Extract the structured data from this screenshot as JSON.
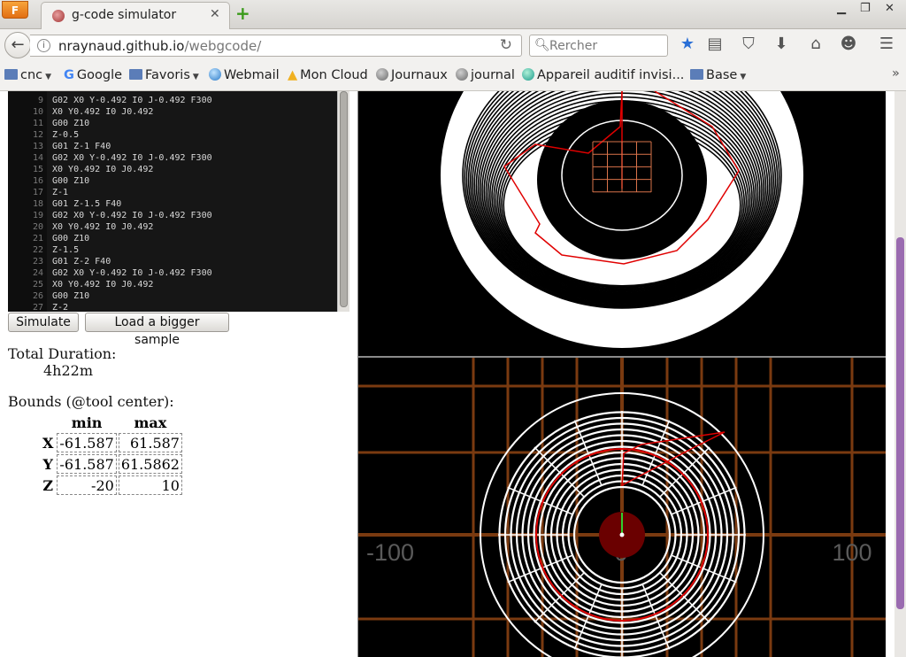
{
  "browser": {
    "menu_label": "F",
    "tab_title": "g-code simulator",
    "tab_close": "✕",
    "new_tab": "+",
    "url_host": "nraynaud.github.io",
    "url_path": "/webgcode/",
    "search_placeholder": "Rercher"
  },
  "bookmarks": [
    {
      "label": "cnc",
      "icon": "folder-icon",
      "dropdown": true
    },
    {
      "label": "Google",
      "icon": "google-icon",
      "dropdown": false
    },
    {
      "label": "Favoris",
      "icon": "folder-icon",
      "dropdown": true
    },
    {
      "label": "Webmail",
      "icon": "globe-icon",
      "dropdown": false
    },
    {
      "label": "Mon Cloud",
      "icon": "cloud-icon",
      "dropdown": false
    },
    {
      "label": "Journaux",
      "icon": "globe-icon",
      "dropdown": false
    },
    {
      "label": "journal",
      "icon": "globe-icon",
      "dropdown": false
    },
    {
      "label": "Appareil auditif invisi...",
      "icon": "globe-icon",
      "dropdown": false
    },
    {
      "label": "Base",
      "icon": "folder-icon",
      "dropdown": true
    }
  ],
  "editor": {
    "lines": [
      {
        "n": "9",
        "code": "G02 X0 Y-0.492 I0 J-0.492 F300"
      },
      {
        "n": "10",
        "code": "X0 Y0.492 I0 J0.492"
      },
      {
        "n": "11",
        "code": "G00 Z10"
      },
      {
        "n": "12",
        "code": "Z-0.5"
      },
      {
        "n": "13",
        "code": "G01 Z-1 F40"
      },
      {
        "n": "14",
        "code": "G02 X0 Y-0.492 I0 J-0.492 F300"
      },
      {
        "n": "15",
        "code": "X0 Y0.492 I0 J0.492"
      },
      {
        "n": "16",
        "code": "G00 Z10"
      },
      {
        "n": "17",
        "code": "Z-1"
      },
      {
        "n": "18",
        "code": "G01 Z-1.5 F40"
      },
      {
        "n": "19",
        "code": "G02 X0 Y-0.492 I0 J-0.492 F300"
      },
      {
        "n": "20",
        "code": "X0 Y0.492 I0 J0.492"
      },
      {
        "n": "21",
        "code": "G00 Z10"
      },
      {
        "n": "22",
        "code": "Z-1.5"
      },
      {
        "n": "23",
        "code": "G01 Z-2 F40"
      },
      {
        "n": "24",
        "code": "G02 X0 Y-0.492 I0 J-0.492 F300"
      },
      {
        "n": "25",
        "code": "X0 Y0.492 I0 J0.492"
      },
      {
        "n": "26",
        "code": "G00 Z10"
      },
      {
        "n": "27",
        "code": "Z-2"
      }
    ]
  },
  "buttons": {
    "simulate": "Simulate",
    "load_sample": "Load a bigger sample"
  },
  "stats": {
    "duration_label": "Total Duration:",
    "duration_value": "4h22m",
    "bounds_label": "Bounds (@tool center):",
    "col_min": "min",
    "col_max": "max",
    "rows": [
      {
        "axis": "X",
        "min": "-61.587",
        "max": "61.587"
      },
      {
        "axis": "Y",
        "min": "-61.587",
        "max": "61.5862"
      },
      {
        "axis": "Z",
        "min": "-20",
        "max": "10"
      }
    ]
  },
  "viewport": {
    "axis_labels": [
      "-100",
      "0",
      "100"
    ],
    "grid_color": "#7a3a10",
    "path_color": "#ffffff",
    "rapid_color": "#e00000"
  }
}
